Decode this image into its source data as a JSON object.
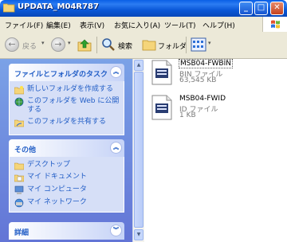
{
  "window": {
    "title": "UPDATA_M04R787"
  },
  "menu": [
    "ファイル(F)",
    "編集(E)",
    "表示(V)",
    "お気に入り(A)",
    "ツール(T)",
    "ヘルプ(H)"
  ],
  "toolbar": {
    "back_label": "戻る",
    "search_label": "検索",
    "folders_label": "フォルダ"
  },
  "tasks_panel": {
    "title": "ファイルとフォルダのタスク",
    "items": [
      {
        "icon": "new-folder-icon",
        "label": "新しいフォルダを作成する"
      },
      {
        "icon": "globe-folder-icon",
        "label_line1": "このフォルダを Web に公開",
        "label_line2": "する"
      },
      {
        "icon": "share-folder-icon",
        "label": "このフォルダを共有する"
      }
    ]
  },
  "other_panel": {
    "title": "その他",
    "items": [
      {
        "icon": "desktop-icon",
        "label": "デスクトップ"
      },
      {
        "icon": "my-documents-icon",
        "label": "マイ ドキュメント"
      },
      {
        "icon": "my-computer-icon",
        "label": "マイ コンピュータ"
      },
      {
        "icon": "my-network-icon",
        "label": "マイ ネットワーク"
      }
    ]
  },
  "details_panel": {
    "title": "詳細"
  },
  "files": [
    {
      "name": "MSB04-FWBIN",
      "type": "BIN ファイル",
      "size": "63,545 KB"
    },
    {
      "name": "MSB04-FWID",
      "type": "ID ファイル",
      "size": "1 KB"
    }
  ],
  "colors": {
    "titlebar": "#0a58d8",
    "taskpane": "#7ba2e7",
    "link": "#215dc6"
  }
}
